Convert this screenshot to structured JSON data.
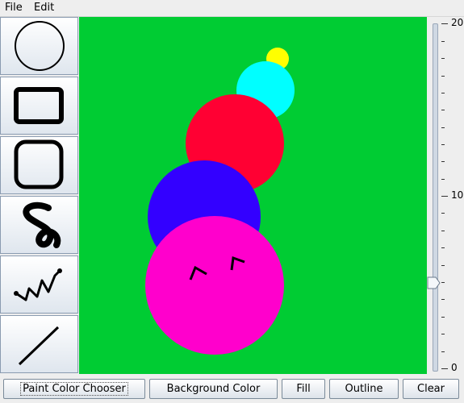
{
  "menu": {
    "file": "File",
    "edit": "Edit"
  },
  "tools": [
    {
      "icon": "circle-tool-icon"
    },
    {
      "icon": "rectangle-tool-icon"
    },
    {
      "icon": "rounded-rectangle-tool-icon"
    },
    {
      "icon": "freehand-tool-icon"
    },
    {
      "icon": "polyline-tool-icon"
    },
    {
      "icon": "line-tool-icon"
    }
  ],
  "canvas": {
    "background": "#00cc33"
  },
  "slider": {
    "max_label": "20",
    "mid_label": "10",
    "min_label": "0",
    "value": 6
  },
  "buttons": {
    "paint_color": "Paint Color Chooser",
    "background_color": "Background Color",
    "fill": "Fill",
    "outline": "Outline",
    "clear": "Clear"
  }
}
